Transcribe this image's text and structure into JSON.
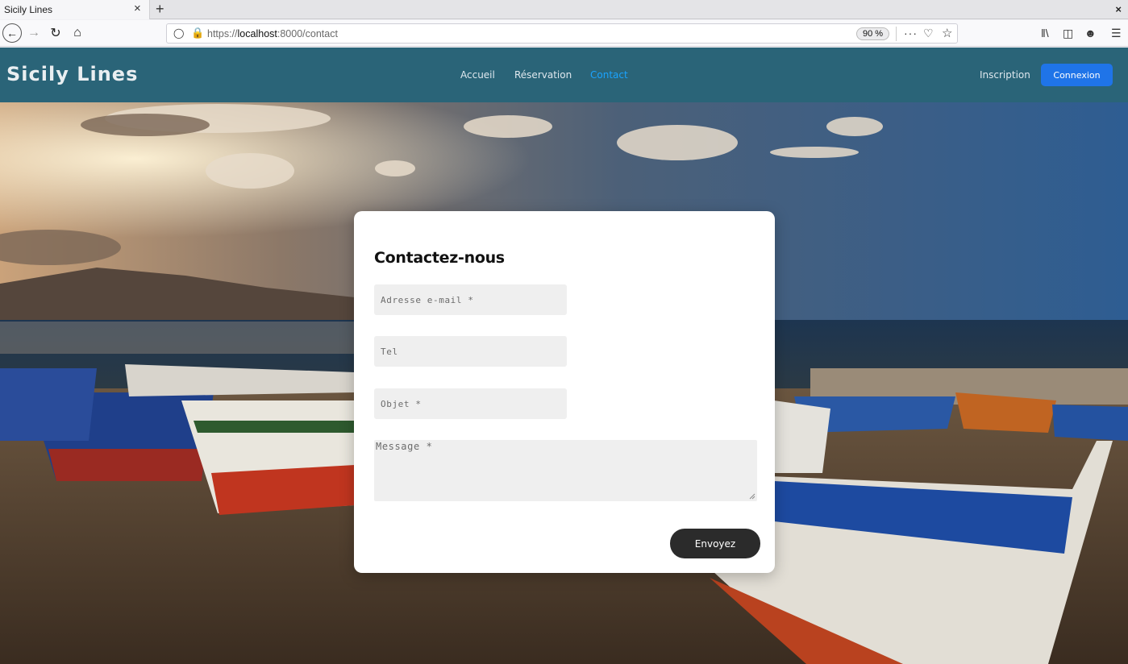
{
  "browser": {
    "tab_title": "Sicily Lines",
    "tab_close": "×",
    "new_tab": "+",
    "window_close": "×",
    "url_host": "localhost",
    "url_prefix": "https://",
    "url_suffix": ":8000/contact",
    "zoom": "90 %",
    "more": "···"
  },
  "site": {
    "brand": "Sicily Lines",
    "nav": [
      {
        "label": "Accueil"
      },
      {
        "label": "Réservation"
      },
      {
        "label": "Contact",
        "active": true
      }
    ],
    "inscription": "Inscription",
    "connexion": "Connexion",
    "colors": {
      "header": "#2a6478",
      "active_link": "#1aa3ff",
      "primary_button": "#1f74e8",
      "send_button": "#2b2b2b"
    }
  },
  "contact_form": {
    "title": "Contactez-nous",
    "email_placeholder": "Adresse e-mail *",
    "tel_placeholder": "Tel",
    "objet_placeholder": "Objet *",
    "message_placeholder": "Message *",
    "submit_label": "Envoyez"
  }
}
